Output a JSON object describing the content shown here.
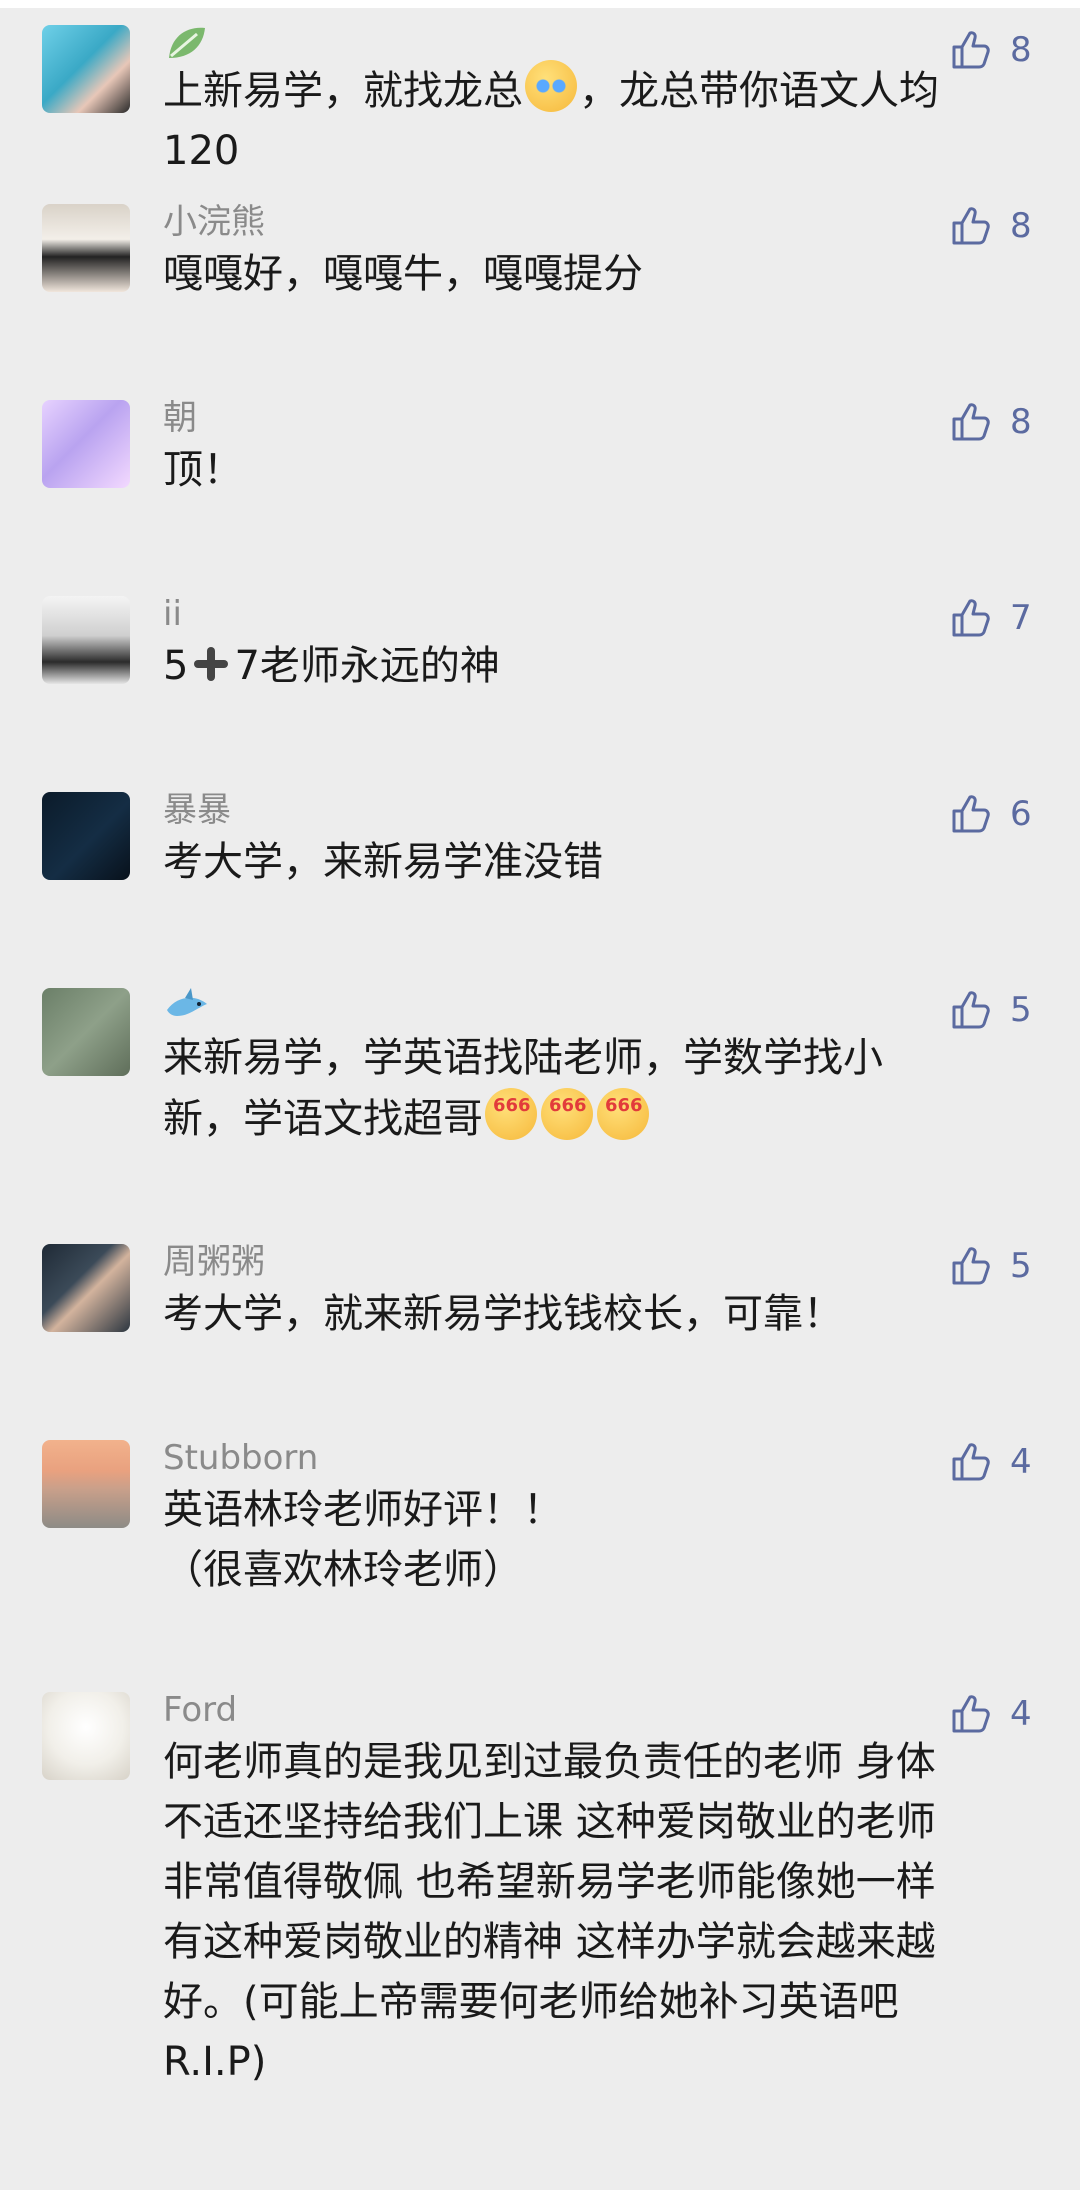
{
  "comments": [
    {
      "name": "",
      "name_icon": "leaf-icon",
      "likes": "8",
      "text_a": "上新易学，就找龙总",
      "text_b": "，龙总带你语文人均\n120"
    },
    {
      "name": "小浣熊",
      "likes": "8",
      "text": "嘎嘎好，嘎嘎牛，嘎嘎提分"
    },
    {
      "name": "朝",
      "likes": "8",
      "text": "顶！"
    },
    {
      "name": "ii",
      "likes": "7",
      "text_a": "5",
      "text_b": "7老师永远的神"
    },
    {
      "name": "暴暴",
      "likes": "6",
      "text": "考大学，来新易学准没错"
    },
    {
      "name": "",
      "name_icon": "shark-icon",
      "likes": "5",
      "text": "来新易学，学英语找陆老师，学数学找小\n新，学语文找超哥"
    },
    {
      "name": "周粥粥",
      "likes": "5",
      "text": "考大学，就来新易学找钱校长，可靠！"
    },
    {
      "name": "Stubborn",
      "likes": "4",
      "text": "英语林玲老师好评！！\n（很喜欢林玲老师）"
    },
    {
      "name": "Ford",
      "likes": "4",
      "text": "何老师真的是我见到过最负责任的老师 身体\n不适还坚持给我们上课 这种爱岗敬业的老师\n非常值得敬佩 也希望新易学老师能像她一样\n有这种爱岗敬业的精神 这样办学就会越来越\n好。(可能上帝需要何老师给她补习英语吧\nR.I.P)"
    }
  ],
  "colors": {
    "background": "#ededed",
    "name": "#8a8a8a",
    "text": "#1a1a1a",
    "like": "#5b6aa0"
  }
}
